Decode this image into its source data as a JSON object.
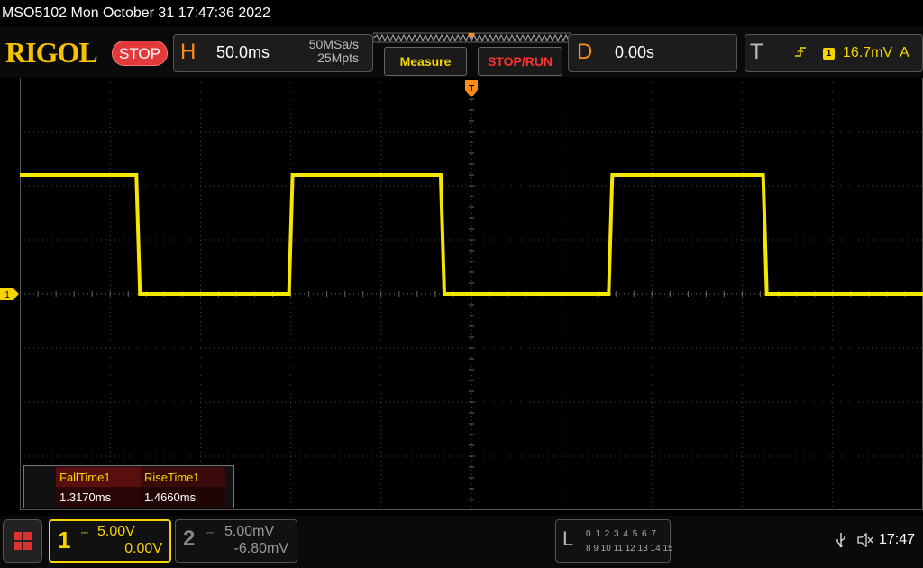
{
  "title": "MSO5102  Mon October 31 17:47:36 2022",
  "header": {
    "logo": "RIGOL",
    "run_state": "STOP",
    "horizontal": {
      "letter": "H",
      "timebase": "50.0ms",
      "sample_rate": "50MSa/s",
      "memory_depth": "25Mpts"
    },
    "measure_label": "Measure",
    "stop_run_label": "STOP/RUN",
    "delay": {
      "letter": "D",
      "value": "0.00s"
    },
    "trigger": {
      "letter": "T",
      "slope_icon": "rising-edge-icon",
      "source": "1",
      "level": "16.7mV",
      "mode": "A"
    }
  },
  "waveform": {
    "channel_marker": "1",
    "trace_color": "#f5e600",
    "trigger_marker_label": "T",
    "transitions": [
      {
        "type": "fall",
        "time_ms": -184.5
      },
      {
        "type": "rise",
        "time_ms": -100.0
      },
      {
        "type": "fall",
        "time_ms": -16.0
      },
      {
        "type": "rise",
        "time_ms": 77.0
      },
      {
        "type": "fall",
        "time_ms": 162.5
      }
    ],
    "start_level": "high",
    "high_div": 2.2,
    "low_div": 0.0
  },
  "measurements": [
    {
      "label": "FallTime1",
      "value": "1.3170ms"
    },
    {
      "label": "RiseTime1",
      "value": "1.4660ms"
    }
  ],
  "footer": {
    "ch1": {
      "number": "1",
      "coupling_icon": "dc-coupling-icon",
      "scale": "5.00V",
      "offset": "0.00V",
      "color": "#f5d400"
    },
    "ch2": {
      "number": "2",
      "coupling_icon": "dc-coupling-icon",
      "scale": "5.00mV",
      "offset": "-6.80mV"
    },
    "logic": {
      "letter": "L",
      "row1": "0 1 2 3  4 5 6 7",
      "row2": "8 9 10 11 12 13 14 15"
    },
    "clock": "17:47"
  }
}
